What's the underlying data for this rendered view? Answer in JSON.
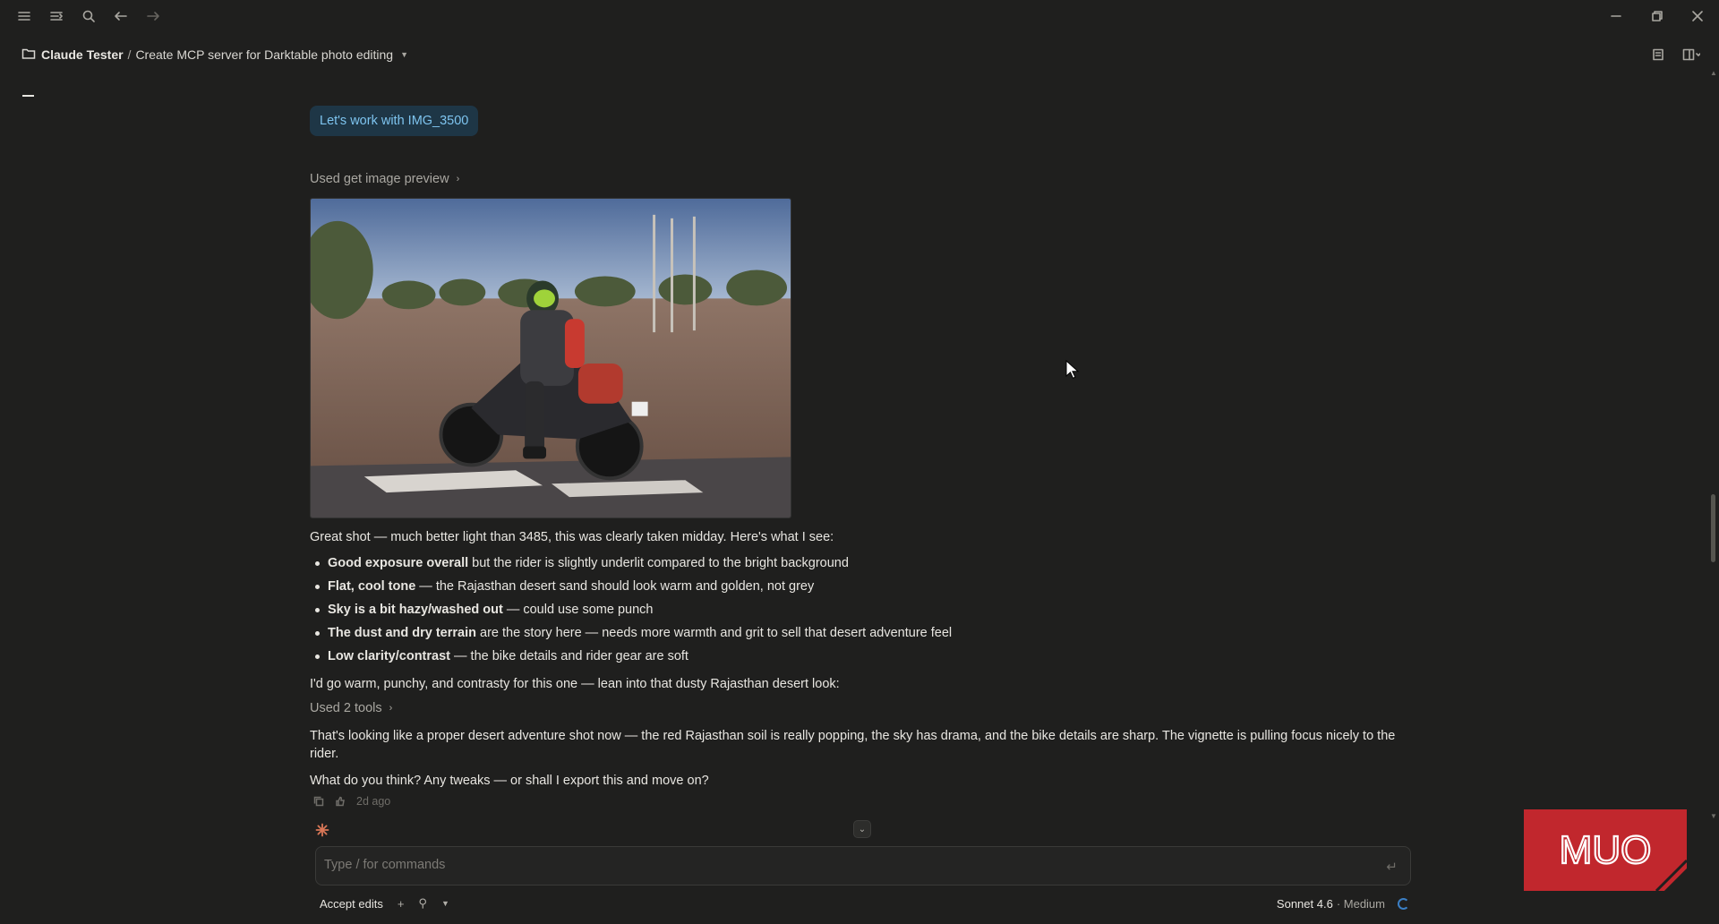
{
  "breadcrumb": {
    "project": "Claude Tester",
    "separator": "/",
    "chat_title": "Create MCP server for Darktable photo editing"
  },
  "conversation": {
    "user_message": "Let's work with IMG_3500",
    "tool_call_1": "Used get image preview",
    "image_alt": "Motorcycle rider in desert scene",
    "intro": "Great shot — much better light than 3485, this was clearly taken midday. Here's what I see:",
    "bullets": [
      {
        "bold": "Good exposure overall",
        "rest": " but the rider is slightly underlit compared to the bright background"
      },
      {
        "bold": "Flat, cool tone",
        "rest": " — the Rajasthan desert sand should look warm and golden, not grey"
      },
      {
        "bold": "Sky is a bit hazy/washed out",
        "rest": " — could use some punch"
      },
      {
        "bold": "The dust and dry terrain",
        "rest": " are the story here — needs more warmth and grit to sell that desert adventure feel"
      },
      {
        "bold": "Low clarity/contrast",
        "rest": " — the bike details and rider gear are soft"
      }
    ],
    "plan": "I'd go warm, punchy, and contrasty for this one — lean into that dusty Rajasthan desert look:",
    "tool_call_2": "Used 2 tools",
    "result": "That's looking like a proper desert adventure shot now — the red Rajasthan soil is really popping, the sky has drama, and the bike details are sharp. The vignette is pulling focus nicely to the rider.",
    "question": "What do you think? Any tweaks — or shall I export this and move on?",
    "timestamp": "2d ago"
  },
  "composer": {
    "placeholder": "Type / for commands"
  },
  "footer": {
    "accept_edits": "Accept edits",
    "model": "Sonnet 4.6",
    "effort": "· Medium"
  },
  "watermark": {
    "text": "MUO"
  },
  "colors": {
    "background": "#1f1f1e",
    "user_bubble_bg": "#1e3646",
    "user_bubble_text": "#7ec4ef",
    "accent_orange": "#d97757",
    "watermark_red": "#c1272d"
  },
  "icons": [
    "menu-icon",
    "sidebar-toggle-icon",
    "search-icon",
    "back-arrow-icon",
    "forward-arrow-icon",
    "minimize-icon",
    "restore-icon",
    "close-icon",
    "folder-icon",
    "notes-icon",
    "panel-icon",
    "copy-icon",
    "thumbs-icon",
    "sparkle-icon"
  ]
}
